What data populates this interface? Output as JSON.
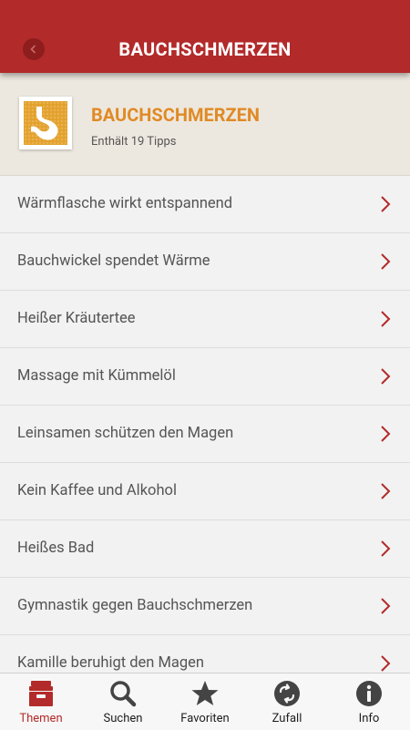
{
  "appbar": {
    "title": "BAUCHSCHMERZEN"
  },
  "topic": {
    "title": "BAUCHSCHMERZEN",
    "subtitle": "Enthält 19 Tipps",
    "icon": "stomach-icon"
  },
  "tips": [
    {
      "label": "Wärmflasche wirkt entspannend"
    },
    {
      "label": "Bauchwickel spendet Wärme"
    },
    {
      "label": "Heißer Kräutertee"
    },
    {
      "label": "Massage mit Kümmelöl"
    },
    {
      "label": "Leinsamen schützen den Magen"
    },
    {
      "label": "Kein Kaffee und Alkohol"
    },
    {
      "label": "Heißes Bad"
    },
    {
      "label": "Gymnastik gegen Bauchschmerzen"
    },
    {
      "label": "Kamille beruhigt den Magen"
    }
  ],
  "nav": {
    "themen": "Themen",
    "suchen": "Suchen",
    "favoriten": "Favoriten",
    "zufall": "Zufall",
    "info": "Info"
  },
  "colors": {
    "accent": "#b32a2a",
    "topic_orange": "#e08a25",
    "chevron": "#b32a2a"
  }
}
